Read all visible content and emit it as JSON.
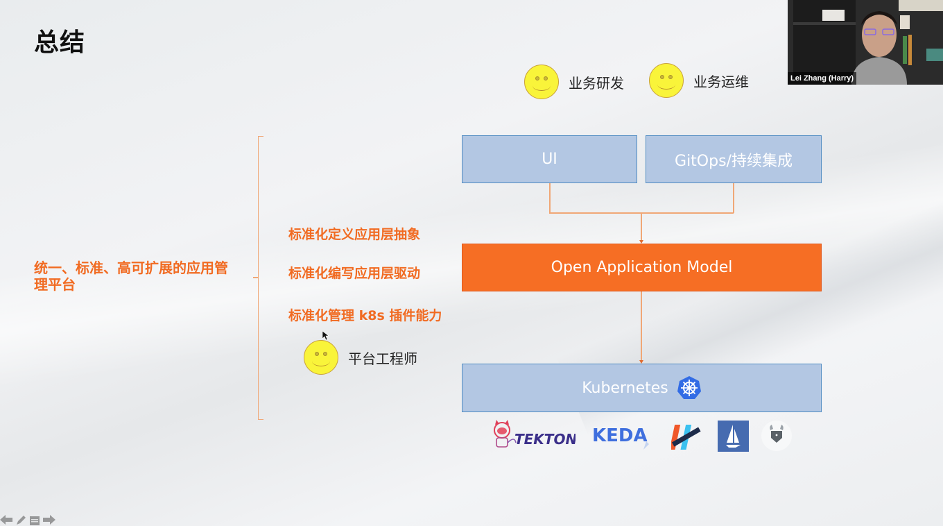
{
  "slide": {
    "title": "总结",
    "left_summary": "统一、标准、高可扩展的应用管理平台",
    "points": [
      "标准化定义应用层抽象",
      "标准化编写应用层驱动",
      "标准化管理 k8s 插件能力"
    ],
    "roles": {
      "dev": "业务研发",
      "ops": "业务运维",
      "platform": "平台工程师"
    },
    "boxes": {
      "ui": "UI",
      "gitops": "GitOps/持续集成",
      "oam": "Open Application Model",
      "k8s": "Kubernetes"
    },
    "ecosystem_logos": [
      "TEKTON",
      "KEDA",
      "tekton-pipelines",
      "istio",
      "open-policy-agent"
    ],
    "colors": {
      "accent_orange": "#f66e24",
      "box_blue": "#b3c7e3",
      "text_orange": "#f16b22"
    }
  },
  "video": {
    "participant_name": "Lei Zhang (Harry)"
  },
  "presenter_controls": [
    "previous",
    "pen",
    "menu",
    "next"
  ]
}
